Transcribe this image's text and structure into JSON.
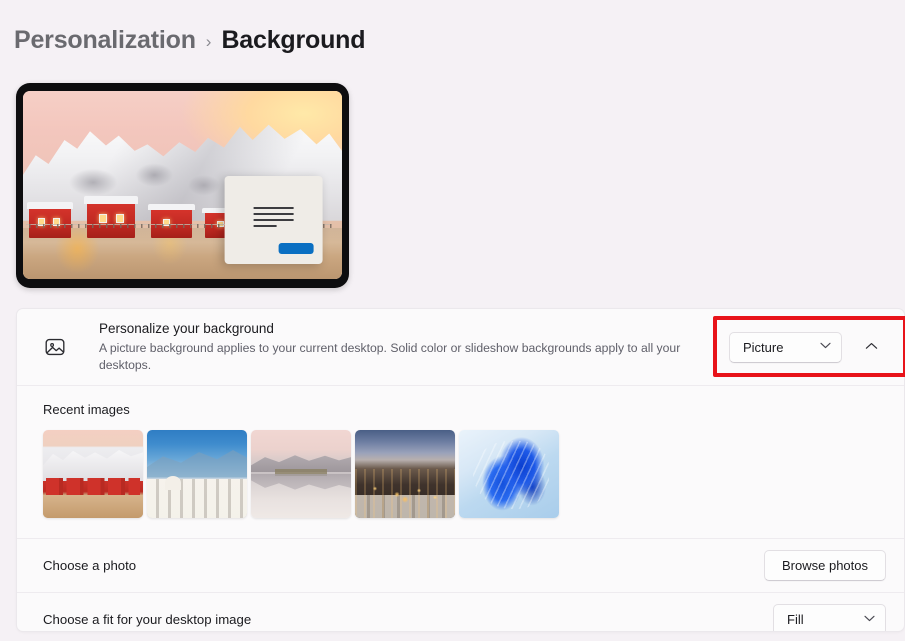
{
  "breadcrumb": {
    "parent": "Personalization",
    "separator": "›",
    "current": "Background"
  },
  "preview": {
    "name": "desktop-background-preview",
    "wallpaper_description": "Snow-covered mountains with red wooden cabins on stilts over water at sunset",
    "dialog_button_color": "#0a6fc2"
  },
  "settings": {
    "personalize": {
      "title": "Personalize your background",
      "description": "A picture background applies to your current desktop. Solid color or slideshow backgrounds apply to all your desktops.",
      "dropdown_value": "Picture",
      "dropdown_chevron": "⌄",
      "expander_chevron": "⌃",
      "highlight_color": "#e8131a"
    },
    "recent_images": {
      "label": "Recent images",
      "thumbnails": [
        {
          "alt": "Red cabins below snowy mountains at sunset"
        },
        {
          "alt": "Blue-toned snowy European town with fortress"
        },
        {
          "alt": "Pale mountain range reflected in a still lake"
        },
        {
          "alt": "Aerial view of a city at dusk with warm lights"
        },
        {
          "alt": "Blue abstract Windows bloom ribbons"
        }
      ]
    },
    "choose_photo": {
      "label": "Choose a photo",
      "button_label": "Browse photos"
    },
    "choose_fit": {
      "label": "Choose a fit for your desktop image",
      "dropdown_value": "Fill",
      "dropdown_chevron": "⌄"
    }
  }
}
